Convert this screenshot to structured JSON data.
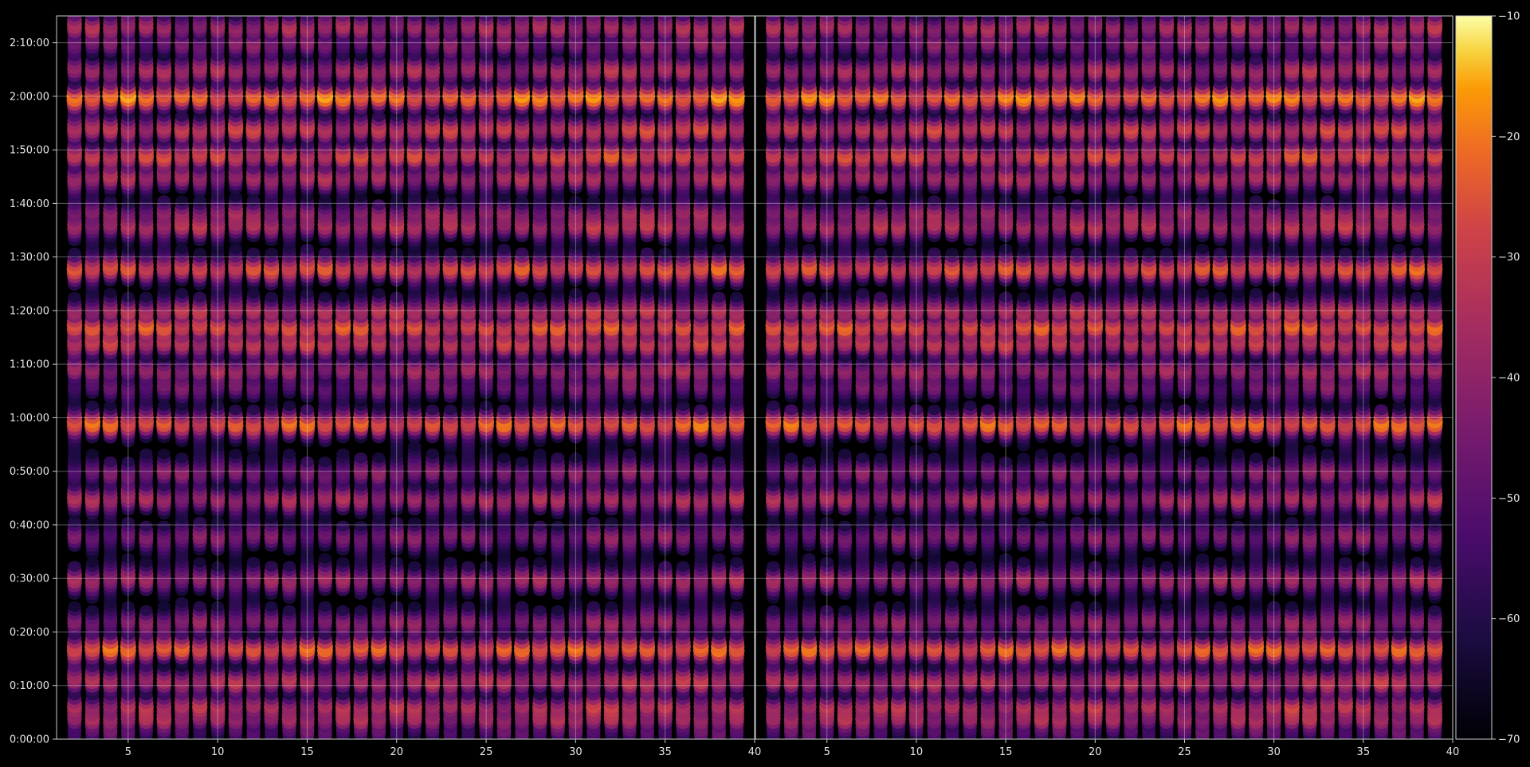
{
  "chart_data": {
    "type": "heatmap",
    "style": {
      "background": "#000000",
      "axis_color": "#cccccc",
      "grid_color": "#ffffff",
      "text_color": "#e6e6e6",
      "colormap": "inferno",
      "marker": "ellipse"
    },
    "grid": true,
    "panels": [
      {
        "name": "",
        "xlim": [
          1,
          40
        ],
        "xticks": [
          5,
          10,
          15,
          20,
          25,
          30,
          35,
          40
        ],
        "ylim_seconds": [
          0,
          8100
        ],
        "yticks_seconds": [
          0,
          600,
          1200,
          1800,
          2400,
          3000,
          3600,
          4200,
          4800,
          5400,
          6000,
          6600,
          7200,
          7800
        ],
        "ytick_labels": [
          "0:00:00",
          "0:10:00",
          "0:20:00",
          "0:30:00",
          "0:40:00",
          "0:50:00",
          "1:00:00",
          "1:10:00",
          "1:20:00",
          "1:30:00",
          "1:40:00",
          "1:50:00",
          "2:00:00",
          "2:10:00"
        ]
      },
      {
        "name": "",
        "xlim": [
          1,
          40
        ],
        "xticks": [
          5,
          10,
          15,
          20,
          25,
          30,
          35,
          40
        ],
        "ylim_seconds": [
          0,
          8100
        ]
      }
    ],
    "rows": {
      "x_values": [
        2,
        3,
        4,
        5,
        6,
        7,
        8,
        9,
        10,
        11,
        12,
        13,
        14,
        15,
        16,
        17,
        18,
        19,
        20,
        21,
        22,
        23,
        24,
        25,
        26,
        27,
        28,
        29,
        30,
        31,
        32,
        33,
        34,
        35,
        36,
        37,
        38,
        39
      ],
      "time_step_seconds": 90,
      "strong_bands": [
        {
          "time": "0:02:00",
          "value": -50
        },
        {
          "time": "0:04:00",
          "value": -38
        },
        {
          "time": "0:06:00",
          "value": -35
        },
        {
          "time": "0:11:00",
          "value": -36
        },
        {
          "time": "0:17:00",
          "value": -25
        },
        {
          "time": "0:22:00",
          "value": -43
        },
        {
          "time": "0:30:00",
          "value": -40
        },
        {
          "time": "0:38:00",
          "value": -45
        },
        {
          "time": "0:45:00",
          "value": -38
        },
        {
          "time": "0:50:00",
          "value": -45
        },
        {
          "time": "0:59:00",
          "value": -25
        },
        {
          "time": "1:06:00",
          "value": -48
        },
        {
          "time": "1:09:00",
          "value": -40
        },
        {
          "time": "1:14:00",
          "value": -33
        },
        {
          "time": "1:17:00",
          "value": -27
        },
        {
          "time": "1:20:00",
          "value": -35
        },
        {
          "time": "1:28:00",
          "value": -28
        },
        {
          "time": "1:36:00",
          "value": -36
        },
        {
          "time": "1:38:00",
          "value": -40
        },
        {
          "time": "1:45:00",
          "value": -38
        },
        {
          "time": "1:49:00",
          "value": -30
        },
        {
          "time": "1:54:00",
          "value": -32
        },
        {
          "time": "2:00:00",
          "value": -22
        },
        {
          "time": "2:05:00",
          "value": -38
        },
        {
          "time": "2:10:00",
          "value": -45
        },
        {
          "time": "2:13:00",
          "value": -38
        }
      ]
    },
    "colorbar": {
      "vmin": -70,
      "vmax": -10,
      "ticks": [
        -10,
        -20,
        -30,
        -40,
        -50,
        -60,
        -70
      ]
    }
  }
}
